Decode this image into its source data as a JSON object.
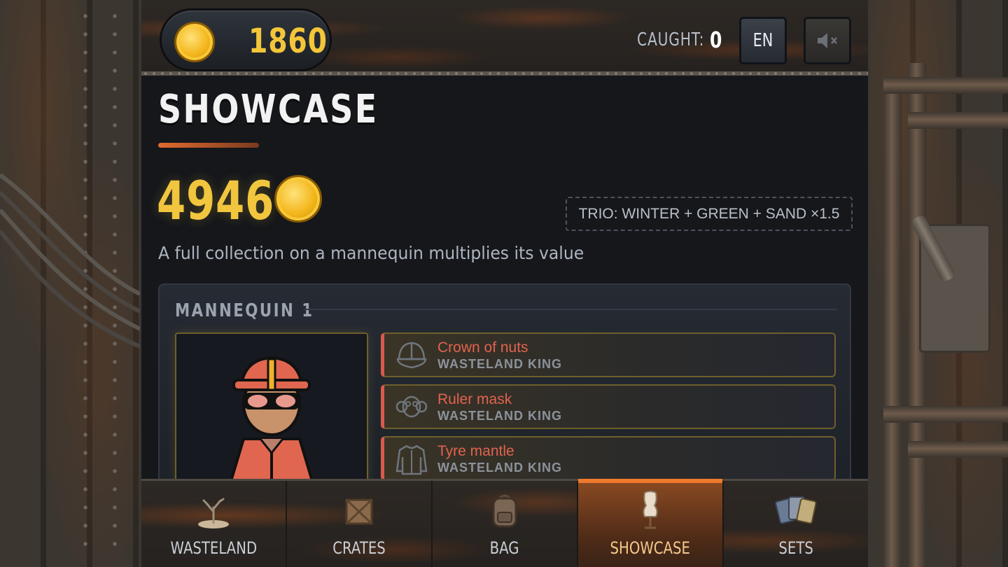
{
  "header": {
    "coins": "1860",
    "caught_label": "CAUGHT:",
    "caught_value": "0",
    "language_button": "EN",
    "sound_icon": "speaker-muted-icon"
  },
  "showcase": {
    "title": "SHOWCASE",
    "total_value": "4946",
    "bonus": "TRIO: WINTER + GREEN + SAND ×1.5",
    "subtitle": "A full collection on a mannequin multiplies its value"
  },
  "mannequin": {
    "label": "MANNEQUIN 1",
    "slots": [
      {
        "name": "Crown of nuts",
        "set": "WASTELAND KING",
        "icon": "helmet-icon"
      },
      {
        "name": "Ruler mask",
        "set": "WASTELAND KING",
        "icon": "gas-mask-icon"
      },
      {
        "name": "Tyre mantle",
        "set": "WASTELAND KING",
        "icon": "jacket-icon"
      }
    ]
  },
  "nav": {
    "tabs": [
      {
        "label": "WASTELAND",
        "icon": "dead-tree-icon",
        "active": false
      },
      {
        "label": "CRATES",
        "icon": "crate-icon",
        "active": false
      },
      {
        "label": "BAG",
        "icon": "backpack-icon",
        "active": false
      },
      {
        "label": "SHOWCASE",
        "icon": "dress-form-icon",
        "active": true
      },
      {
        "label": "SETS",
        "icon": "cards-icon",
        "active": false
      }
    ]
  },
  "colors": {
    "gold": "#f1c63e",
    "accent_orange": "#ef7a2c",
    "slot_name": "#e2634f",
    "panel_bg": "#15171b"
  }
}
